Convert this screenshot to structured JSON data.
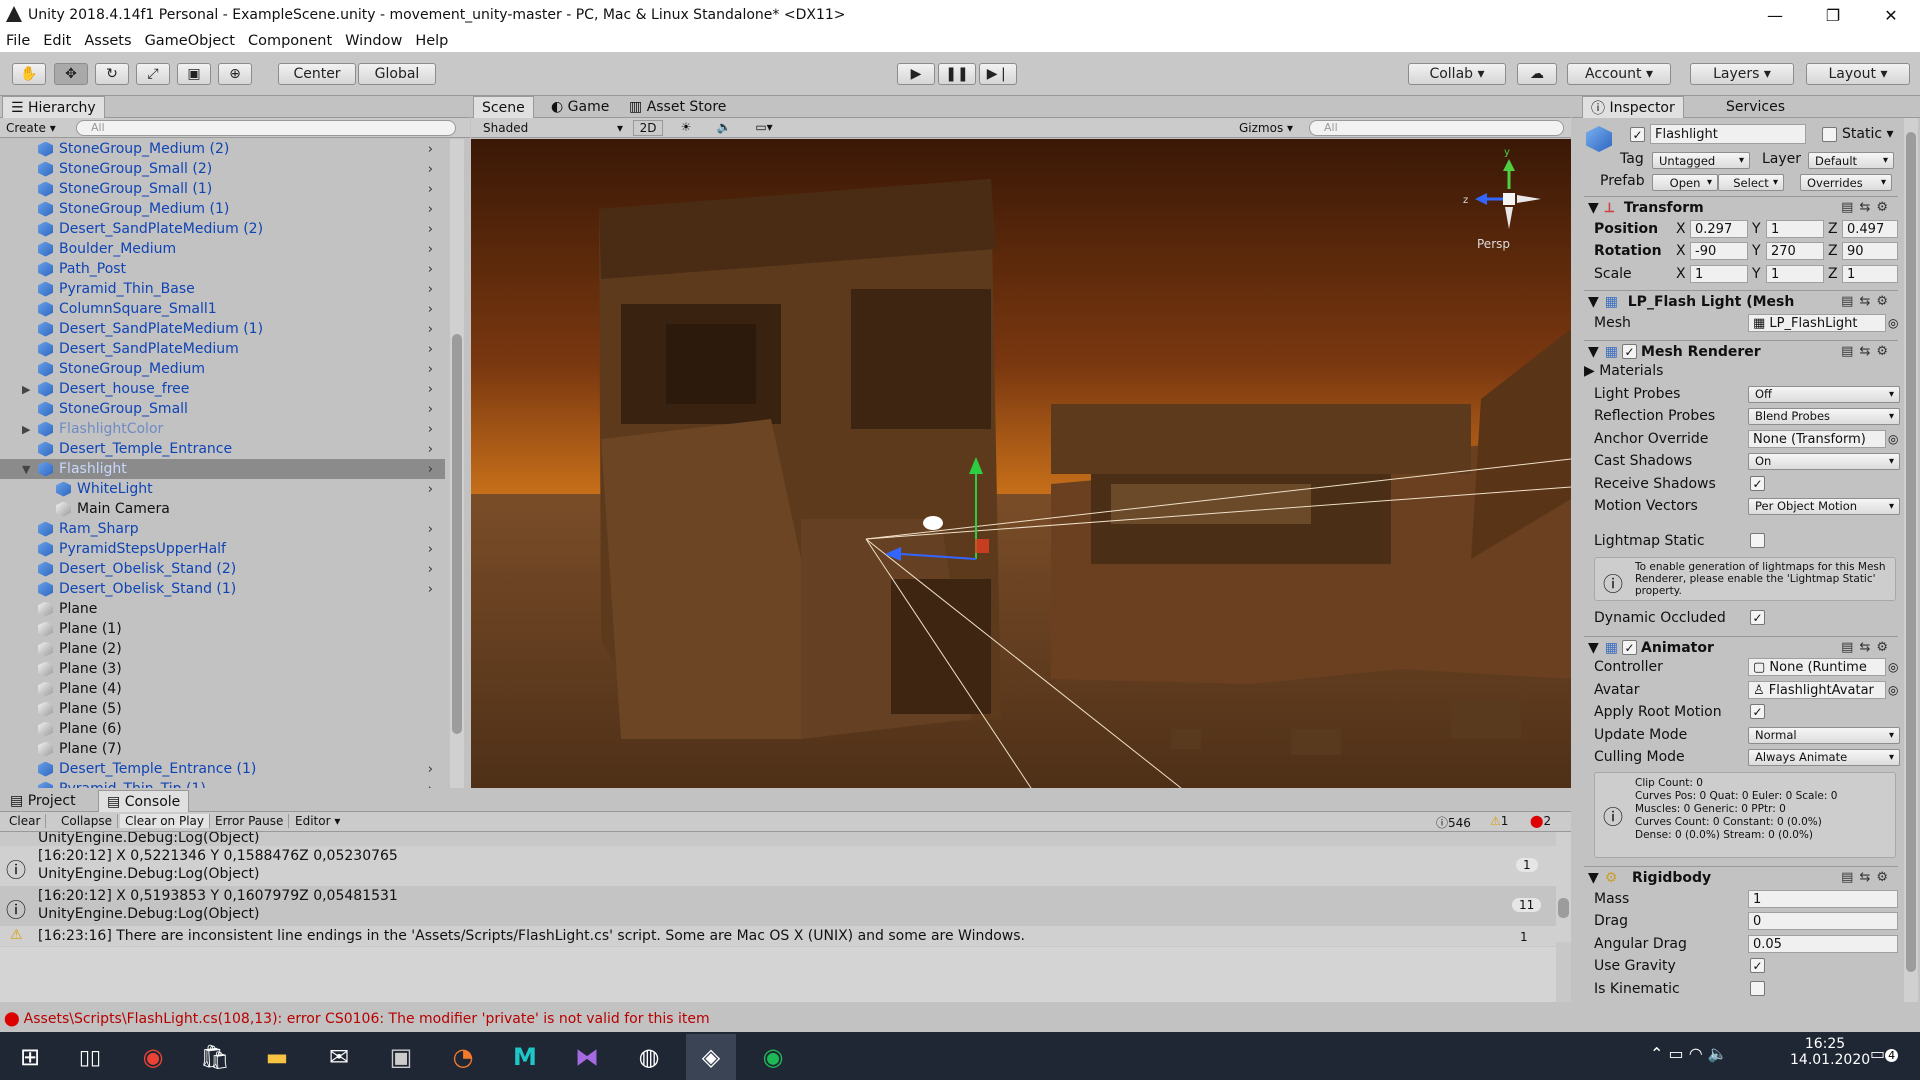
{
  "window": {
    "title": "Unity 2018.4.14f1 Personal - ExampleScene.unity - movement_unity-master - PC, Mac & Linux Standalone* <DX11>",
    "minimize": "—",
    "maximize": "❐",
    "close": "✕"
  },
  "menu": [
    "File",
    "Edit",
    "Assets",
    "GameObject",
    "Component",
    "Window",
    "Help"
  ],
  "toolbar": {
    "center": "Center",
    "global": "Global",
    "collab": "Collab",
    "account": "Account",
    "layers": "Layers",
    "layout": "Layout"
  },
  "hierarchy": {
    "tab": "Hierarchy",
    "create": "Create",
    "search_placeholder": "All",
    "items": [
      {
        "name": "StoneGroup_Medium (2)",
        "type": "prefab",
        "arrow": true
      },
      {
        "name": "StoneGroup_Small (2)",
        "type": "prefab",
        "arrow": true
      },
      {
        "name": "StoneGroup_Small (1)",
        "type": "prefab",
        "arrow": true
      },
      {
        "name": "StoneGroup_Medium (1)",
        "type": "prefab",
        "arrow": true
      },
      {
        "name": "Desert_SandPlateMedium (2)",
        "type": "prefab",
        "arrow": true
      },
      {
        "name": "Boulder_Medium",
        "type": "prefab",
        "arrow": true
      },
      {
        "name": "Path_Post",
        "type": "prefab",
        "arrow": true
      },
      {
        "name": "Pyramid_Thin_Base",
        "type": "prefab",
        "arrow": true
      },
      {
        "name": "ColumnSquare_Small1",
        "type": "prefab",
        "arrow": true
      },
      {
        "name": "Desert_SandPlateMedium (1)",
        "type": "prefab",
        "arrow": true
      },
      {
        "name": "Desert_SandPlateMedium",
        "type": "prefab",
        "arrow": true
      },
      {
        "name": "StoneGroup_Medium",
        "type": "prefab",
        "arrow": true
      },
      {
        "name": "Desert_house_free",
        "type": "prefab",
        "arrow": true,
        "expand": "▶"
      },
      {
        "name": "StoneGroup_Small",
        "type": "prefab",
        "arrow": true
      },
      {
        "name": "FlashlightColor",
        "type": "prefab-faded",
        "arrow": true,
        "expand": "▶"
      },
      {
        "name": "Desert_Temple_Entrance",
        "type": "prefab",
        "arrow": true
      },
      {
        "name": "Flashlight",
        "type": "selected",
        "arrow": true,
        "expand": "▼"
      },
      {
        "name": "WhiteLight",
        "type": "child-prefab",
        "arrow": true
      },
      {
        "name": "Main Camera",
        "type": "child"
      },
      {
        "name": "Ram_Sharp",
        "type": "prefab",
        "arrow": true
      },
      {
        "name": "PyramidStepsUpperHalf",
        "type": "prefab",
        "arrow": true
      },
      {
        "name": "Desert_Obelisk_Stand (2)",
        "type": "prefab",
        "arrow": true
      },
      {
        "name": "Desert_Obelisk_Stand (1)",
        "type": "prefab",
        "arrow": true
      },
      {
        "name": "Plane",
        "type": "plain"
      },
      {
        "name": "Plane (1)",
        "type": "plain"
      },
      {
        "name": "Plane (2)",
        "type": "plain"
      },
      {
        "name": "Plane (3)",
        "type": "plain"
      },
      {
        "name": "Plane (4)",
        "type": "plain"
      },
      {
        "name": "Plane (5)",
        "type": "plain"
      },
      {
        "name": "Plane (6)",
        "type": "plain"
      },
      {
        "name": "Plane (7)",
        "type": "plain"
      },
      {
        "name": "Desert_Temple_Entrance (1)",
        "type": "prefab",
        "arrow": true
      },
      {
        "name": "Pyramid_Thin_Tip (1)",
        "type": "prefab",
        "arrow": true
      }
    ]
  },
  "scene": {
    "tabs": [
      "Scene",
      "Game",
      "Asset Store"
    ],
    "shading": "Shaded",
    "mode2d": "2D",
    "gizmos": "Gizmos",
    "search_placeholder": "All",
    "persp": "Persp",
    "gizmo_y": "y",
    "gizmo_z": "z"
  },
  "inspector": {
    "tabs": [
      "Inspector",
      "Services"
    ],
    "object_name": "Flashlight",
    "static_label": "Static",
    "tag_label": "Tag",
    "tag": "Untagged",
    "layer_label": "Layer",
    "layer": "Default",
    "prefab_label": "Prefab",
    "open": "Open",
    "select": "Select",
    "overrides": "Overrides",
    "transform": {
      "title": "Transform",
      "position_label": "Position",
      "rotation_label": "Rotation",
      "scale_label": "Scale",
      "position": {
        "x": "0.297",
        "y": "1",
        "z": "0.497"
      },
      "rotation": {
        "x": "-90",
        "y": "270",
        "z": "90"
      },
      "scale": {
        "x": "1",
        "y": "1",
        "z": "1"
      },
      "x": "X",
      "y": "Y",
      "z": "Z"
    },
    "meshfilter": {
      "title": "LP_Flash Light (Mesh",
      "mesh_label": "Mesh",
      "mesh": "LP_FlashLight"
    },
    "meshrenderer": {
      "title": "Mesh Renderer",
      "materials": "Materials",
      "light_probes_label": "Light Probes",
      "light_probes": "Off",
      "reflection_label": "Reflection Probes",
      "reflection": "Blend Probes",
      "anchor_label": "Anchor Override",
      "anchor": "None (Transform)",
      "cast_label": "Cast Shadows",
      "cast": "On",
      "receive_label": "Receive Shadows",
      "motion_label": "Motion Vectors",
      "motion": "Per Object Motion",
      "lightmap_label": "Lightmap Static",
      "info": "To enable generation of lightmaps for this Mesh Renderer, please enable the 'Lightmap Static' property.",
      "dynamic_label": "Dynamic Occluded"
    },
    "animator": {
      "title": "Animator",
      "controller_label": "Controller",
      "controller": "None (Runtime",
      "avatar_label": "Avatar",
      "avatar": "FlashlightAvatar",
      "root_label": "Apply Root Motion",
      "update_label": "Update Mode",
      "update": "Normal",
      "culling_label": "Culling Mode",
      "culling": "Always Animate",
      "stats": [
        "Clip Count: 0",
        "Curves Pos: 0 Quat: 0 Euler: 0 Scale: 0",
        "Muscles: 0 Generic: 0 PPtr: 0",
        "Curves Count: 0 Constant: 0 (0.0%)",
        "Dense: 0 (0.0%) Stream: 0 (0.0%)"
      ]
    },
    "rigidbody": {
      "title": "Rigidbody",
      "mass_label": "Mass",
      "mass": "1",
      "drag_label": "Drag",
      "drag": "0",
      "angular_label": "Angular Drag",
      "angular": "0.05",
      "gravity_label": "Use Gravity",
      "kinematic_label": "Is Kinematic"
    }
  },
  "console": {
    "tabs": [
      "Project",
      "Console"
    ],
    "buttons": [
      "Clear",
      "Collapse",
      "Clear on Play",
      "Error Pause",
      "Editor"
    ],
    "count_log": "546",
    "count_warn": "1",
    "count_error": "2",
    "partial": "UnityEngine.Debug:Log(Object)",
    "entries": [
      {
        "line1": "[16:20:12] X 0,5221346 Y 0,1588476Z 0,05230765",
        "line2": "UnityEngine.Debug:Log(Object)",
        "count": "1"
      },
      {
        "line1": "[16:20:12] X 0,5193853 Y 0,1607979Z 0,05481531",
        "line2": "UnityEngine.Debug:Log(Object)",
        "count": "11"
      }
    ],
    "warning": "[16:23:16] There are inconsistent line endings in the 'Assets/Scripts/FlashLight.cs' script. Some are Mac OS X (UNIX) and some are Windows.",
    "warning_count": "1"
  },
  "statusbar": "Assets\\Scripts\\FlashLight.cs(108,13): error CS0106: The modifier 'private' is not valid for this item",
  "taskbar": {
    "time": "16:25",
    "date": "14.01.2020",
    "notifications": "4"
  },
  "colors": {
    "selection": "#8b8b8b",
    "prefab_text": "#0f44b4",
    "taskbar": "#1f2734",
    "sky_top": "#3a1806",
    "sky_horizon": "#d8871e"
  }
}
